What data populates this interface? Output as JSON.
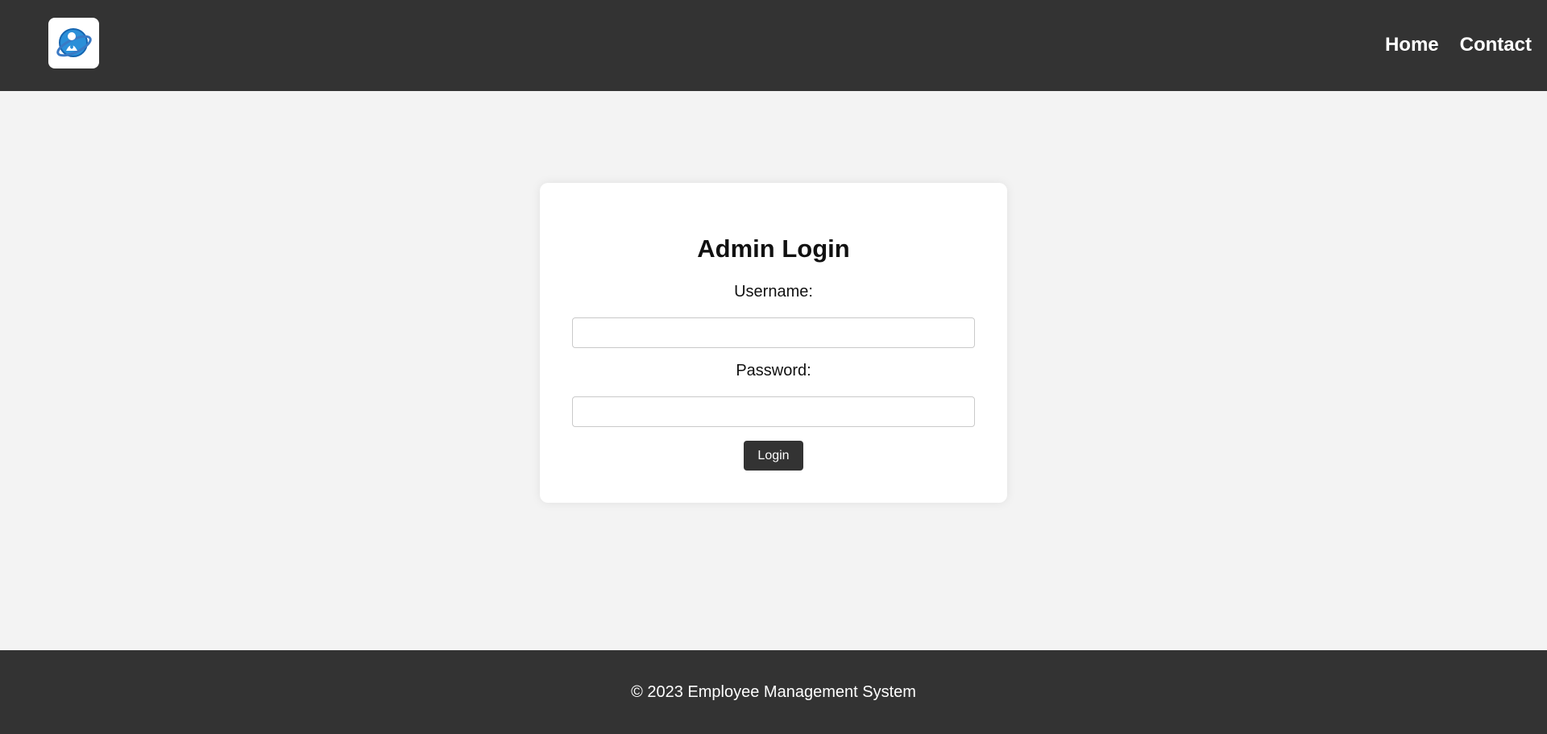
{
  "header": {
    "logo_icon": "employee-globe-logo-icon",
    "nav": [
      {
        "label": "Home"
      },
      {
        "label": "Contact"
      }
    ]
  },
  "login": {
    "title": "Admin Login",
    "username_label": "Username:",
    "username_value": "",
    "password_label": "Password:",
    "password_value": "",
    "submit_label": "Login"
  },
  "footer": {
    "text": "© 2023 Employee Management System"
  },
  "colors": {
    "header_bg": "#333333",
    "page_bg": "#f3f3f3",
    "card_bg": "#ffffff",
    "button_bg": "#333333"
  }
}
